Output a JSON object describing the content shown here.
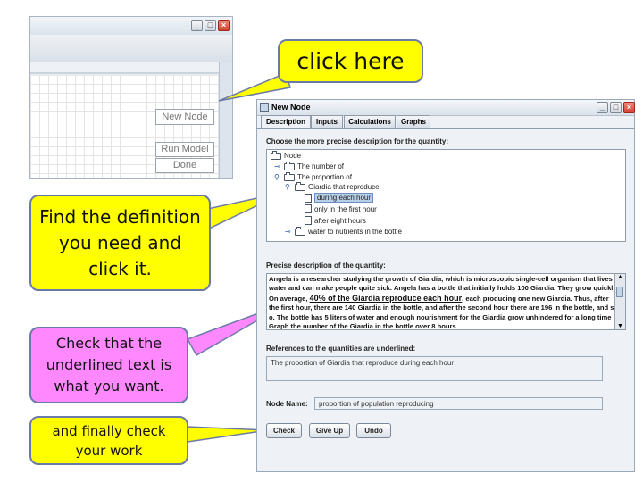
{
  "background_window": {
    "canvas_buttons": {
      "new_node": "New Node",
      "run_model": "Run Model",
      "done": "Done"
    }
  },
  "callouts": {
    "click_here": "click here",
    "find_definition": "Find the definition you need and click it.",
    "check_underlined": "Check that the underlined text is what you want.",
    "check_work": "and finally check your work"
  },
  "dialog": {
    "title": "New Node",
    "tabs": [
      "Description",
      "Inputs",
      "Calculations",
      "Graphs"
    ],
    "choose_label": "Choose the more precise description for the quantity:",
    "tree": {
      "root": "Node",
      "items": [
        "The number of",
        "The proportion of",
        "Giardia that reproduce",
        "during each hour",
        "only in the first hour",
        "after eight hours",
        "water to nutrients in the bottle"
      ]
    },
    "precise_label": "Precise description of the quantity:",
    "description": {
      "line1": "Angela is a researcher studying the growth of Giardia, which is microscopic single-cell organism that lives",
      "line2": "water and can make people quite sick. Angela has a bottle that initially holds 100 Giardia. They grow quickly",
      "line3_pre": "On average, ",
      "line3_underlined": "40% of the Giardia reproduce each hour",
      "line3_post": ", each producing one new Giardia. Thus, after",
      "line4": "the first hour, there are 140 Giardia in the bottle, and after the second hour there are 196 in the bottle, and s",
      "line5": "o. The bottle has 5 liters of water and enough nourishment for the Giardia grow unhindered for a long time",
      "line6": "Graph the number of the Giardia in the bottle over 8 hours"
    },
    "references_label": "References to the quantities are underlined:",
    "references_text": "The proportion of Giardia that reproduce during each hour",
    "node_name_label": "Node Name:",
    "node_name_value": "proportion of population reproducing",
    "buttons": {
      "check": "Check",
      "give_up": "Give Up",
      "undo": "Undo"
    }
  },
  "colors": {
    "callout_yellow": "#ffff00",
    "callout_pink": "#ff88ff",
    "close_button": "#d0412e"
  }
}
